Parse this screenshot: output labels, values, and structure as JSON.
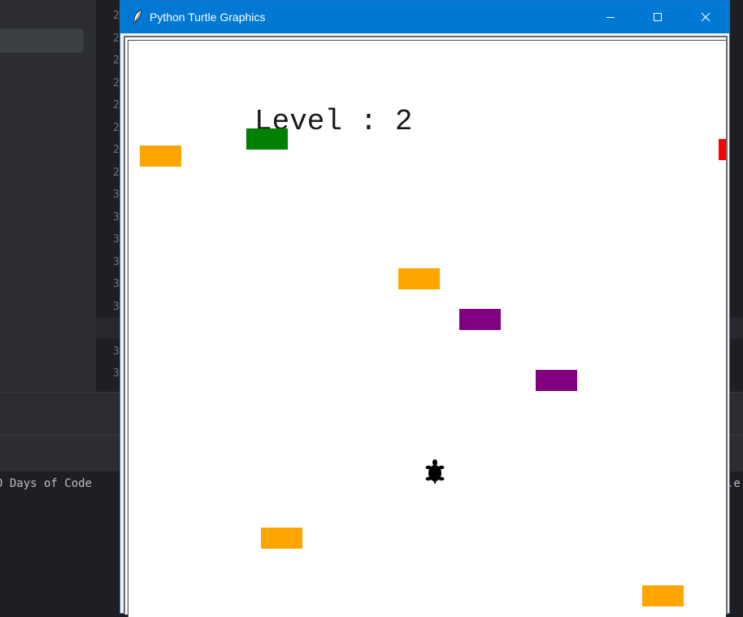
{
  "ide": {
    "line_numbers": [
      "2",
      "2",
      "2",
      "2",
      "2",
      "2",
      "2",
      "2",
      "3",
      "3",
      "3",
      "3",
      "3",
      "3",
      "3",
      "3",
      "3"
    ],
    "terminal_text_left": "0 Days of Code",
    "terminal_text_right": ".e"
  },
  "turtle_window": {
    "icon": "feather-icon",
    "title": "Python Turtle Graphics",
    "controls": [
      "minimize-icon",
      "maximize-icon",
      "close-icon"
    ]
  },
  "game": {
    "level_label": "Level : 2",
    "player": "turtle-icon",
    "cars": [
      {
        "color": "#ffa500"
      },
      {
        "color": "#008000"
      },
      {
        "color": "#ff0000"
      },
      {
        "color": "#ffa500"
      },
      {
        "color": "#800080"
      },
      {
        "color": "#800080"
      },
      {
        "color": "#ffa500"
      },
      {
        "color": "#ffa500"
      }
    ]
  },
  "colors": {
    "titlebar": "#0078d4",
    "ide_background": "#1e1f22"
  }
}
